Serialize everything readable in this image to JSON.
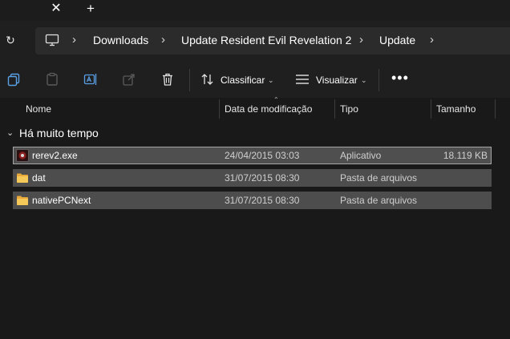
{
  "tabstrip": {
    "close_glyph": "✕",
    "new_tab_glyph": "+"
  },
  "address": {
    "refresh_glyph": "↻",
    "breadcrumbs": [
      "Downloads",
      "Update Resident Evil Revelation 2",
      "Update"
    ],
    "chevron": "›"
  },
  "toolbar": {
    "sort_label": "Classificar",
    "view_label": "Visualizar",
    "more_label": "•••",
    "dropdown_glyph": "⌄"
  },
  "columns": {
    "name": "Nome",
    "date": "Data de modificação",
    "type": "Tipo",
    "size": "Tamanho"
  },
  "group": {
    "label": "Há muito tempo",
    "chevron": "⌄"
  },
  "files": [
    {
      "name": "rerev2.exe",
      "date": "24/04/2015 03:03",
      "type": "Aplicativo",
      "size": "18.119 KB",
      "icon": "app-icon"
    },
    {
      "name": "dat",
      "date": "31/07/2015 08:30",
      "type": "Pasta de arquivos",
      "size": "",
      "icon": "folder-icon"
    },
    {
      "name": "nativePCNext",
      "date": "31/07/2015 08:30",
      "type": "Pasta de arquivos",
      "size": "",
      "icon": "folder-icon"
    }
  ],
  "colors": {
    "background": "#191919",
    "selection": "#4d4d4d",
    "folder": "#f2c14e",
    "app_icon": "#8b1e1e"
  }
}
